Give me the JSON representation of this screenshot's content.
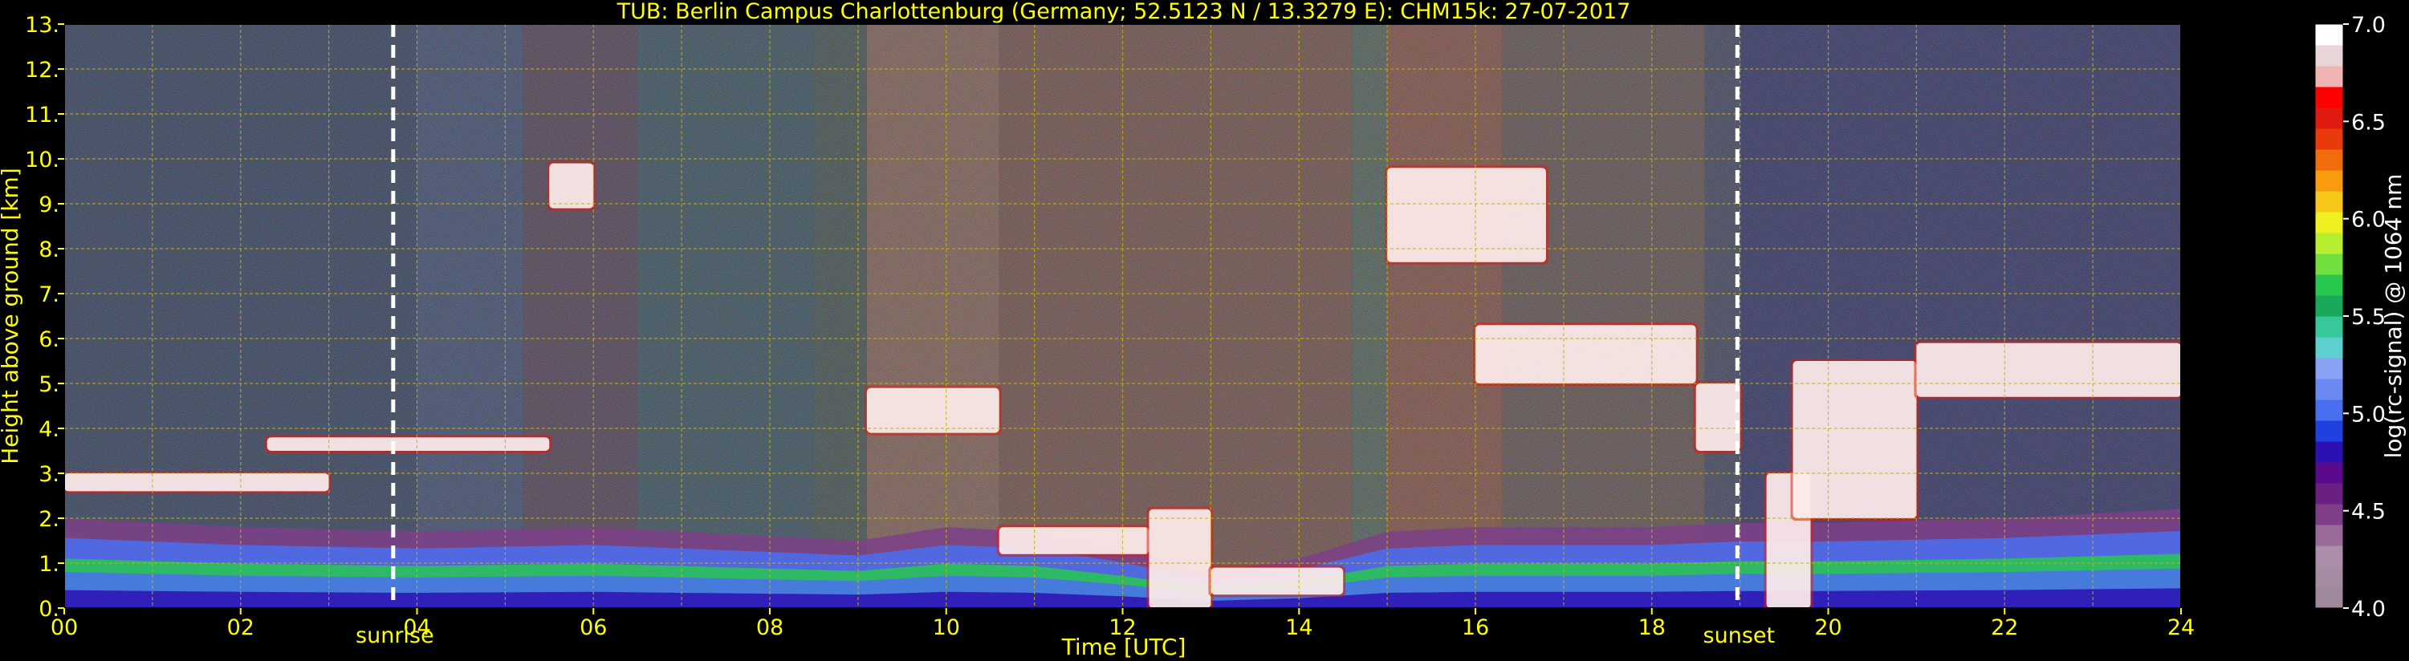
{
  "chart_data": {
    "type": "heatmap",
    "title": "TUB: Berlin Campus Charlottenburg (Germany; 52.5123 N / 13.3279 E):    CHM15k: 27-07-2017",
    "xlabel": "Time [UTC]",
    "ylabel": "Height above ground [km]",
    "xlim": [
      0,
      24
    ],
    "ylim": [
      0,
      13
    ],
    "x_ticks": [
      "00",
      "02",
      "04",
      "06",
      "08",
      "10",
      "12",
      "14",
      "16",
      "18",
      "20",
      "22",
      "24"
    ],
    "y_ticks": [
      "0.",
      "1.",
      "2.",
      "3.",
      "4.",
      "5.",
      "6.",
      "7.",
      "8.",
      "9.",
      "10.",
      "11.",
      "12.",
      "13."
    ],
    "grid": true,
    "colorbar": {
      "label": "log(rc-signal) @ 1064 nm",
      "range": [
        4.0,
        7.0
      ],
      "ticks": [
        "4.0",
        "4.5",
        "5.0",
        "5.5",
        "6.0",
        "6.5",
        "7.0"
      ],
      "colors": [
        "#9e8a9c",
        "#a58ca3",
        "#ad8eaa",
        "#9a6b98",
        "#7e3f88",
        "#6a1f82",
        "#5a0a8c",
        "#2d10b3",
        "#2040e0",
        "#4a6ef0",
        "#6a8af2",
        "#8aa2f4",
        "#5ecfcf",
        "#36c89a",
        "#1aa85a",
        "#28c850",
        "#70e040",
        "#b8ee30",
        "#f0f020",
        "#f8c818",
        "#fa9a10",
        "#f26b0c",
        "#e83a0a",
        "#e01a10",
        "#ff0000",
        "#f0b4b4",
        "#e8d6d8",
        "#ffffff"
      ]
    },
    "annotations": [
      {
        "label": "sunrise",
        "x": 3.73
      },
      {
        "label": "sunset",
        "x": 18.97
      }
    ],
    "features": {
      "boundary_layer_top_km": [
        [
          0,
          2.0
        ],
        [
          1,
          1.9
        ],
        [
          2,
          1.8
        ],
        [
          3,
          1.75
        ],
        [
          4,
          1.7
        ],
        [
          5,
          1.75
        ],
        [
          6,
          1.8
        ],
        [
          7,
          1.7
        ],
        [
          8,
          1.6
        ],
        [
          9,
          1.5
        ],
        [
          10,
          1.8
        ],
        [
          11,
          1.7
        ],
        [
          12,
          1.3
        ],
        [
          13,
          0.8
        ],
        [
          14,
          1.1
        ],
        [
          15,
          1.7
        ],
        [
          16,
          1.8
        ],
        [
          17,
          1.8
        ],
        [
          18,
          1.8
        ],
        [
          19,
          1.9
        ],
        [
          20,
          1.9
        ],
        [
          22,
          2.0
        ],
        [
          24,
          2.2
        ]
      ],
      "cloud_layers": [
        {
          "t0": 0.0,
          "t1": 3.0,
          "z0": 2.6,
          "z1": 3.0
        },
        {
          "t0": 2.3,
          "t1": 5.5,
          "z0": 3.5,
          "z1": 3.8
        },
        {
          "t0": 5.5,
          "t1": 6.0,
          "z0": 8.9,
          "z1": 9.9
        },
        {
          "t0": 9.1,
          "t1": 10.6,
          "z0": 3.9,
          "z1": 4.9
        },
        {
          "t0": 10.6,
          "t1": 12.3,
          "z0": 1.2,
          "z1": 1.8
        },
        {
          "t0": 12.3,
          "t1": 13.0,
          "z0": 0.0,
          "z1": 2.2
        },
        {
          "t0": 13.0,
          "t1": 14.5,
          "z0": 0.3,
          "z1": 0.9
        },
        {
          "t0": 15.0,
          "t1": 16.8,
          "z0": 7.7,
          "z1": 9.8
        },
        {
          "t0": 16.0,
          "t1": 18.5,
          "z0": 5.0,
          "z1": 6.3
        },
        {
          "t0": 18.5,
          "t1": 19.0,
          "z0": 3.5,
          "z1": 5.0
        },
        {
          "t0": 19.3,
          "t1": 19.8,
          "z0": 0.0,
          "z1": 3.0
        },
        {
          "t0": 19.6,
          "t1": 21.0,
          "z0": 2.0,
          "z1": 5.5
        },
        {
          "t0": 21.0,
          "t1": 24.0,
          "z0": 4.7,
          "z1": 5.9
        }
      ]
    }
  }
}
